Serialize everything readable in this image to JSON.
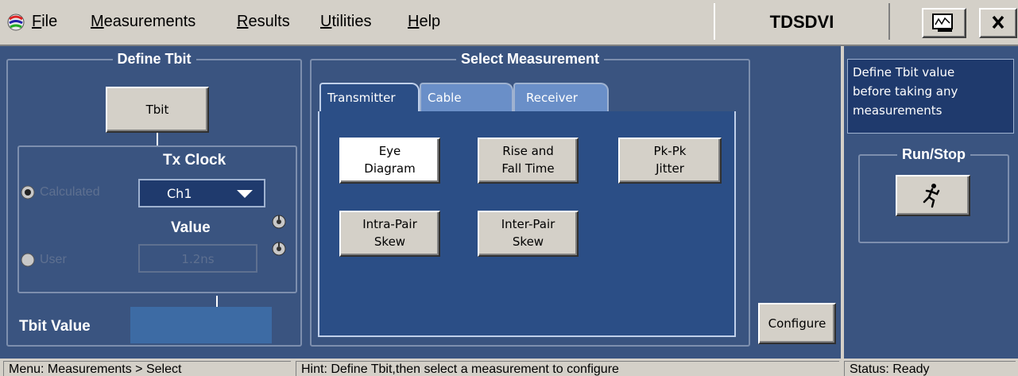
{
  "menu": {
    "items": [
      "File",
      "Measurements",
      "Results",
      "Utilities",
      "Help"
    ],
    "accel": [
      "F",
      "M",
      "R",
      "U",
      "H"
    ]
  },
  "title": "TDSDVI",
  "define_tbit": {
    "title": "Define Tbit",
    "tbit_button": "Tbit",
    "tx_clock_title": "Tx Clock",
    "calculated_label": "Calculated",
    "source_value": "Ch1",
    "value_label": "Value",
    "user_label": "User",
    "user_value": "1.2ns",
    "tbit_value_label": "Tbit Value",
    "tbit_value": ""
  },
  "select_measurement": {
    "title": "Select Measurement",
    "tabs": [
      "Transmitter",
      "Cable",
      "Receiver"
    ],
    "active_tab": "Transmitter",
    "buttons": [
      {
        "line1": "Eye",
        "line2": "Diagram"
      },
      {
        "line1": "Rise and",
        "line2": "Fall Time"
      },
      {
        "line1": "Pk-Pk",
        "line2": "Jitter"
      },
      {
        "line1": "Intra-Pair",
        "line2": "Skew"
      },
      {
        "line1": "Inter-Pair",
        "line2": "Skew"
      }
    ],
    "configure": "Configure"
  },
  "side": {
    "hint": [
      "Define Tbit value",
      "before taking any",
      "measurements"
    ],
    "run_stop_title": "Run/Stop"
  },
  "status": {
    "menu": "Menu: Measurements > Select",
    "hint": "Hint: Define Tbit,then select a measurement to configure",
    "state": "Status: Ready"
  },
  "colors": {
    "panel": "#3a5480",
    "chrome": "#d4d0c8",
    "hint_box": "#1f3a6d"
  }
}
